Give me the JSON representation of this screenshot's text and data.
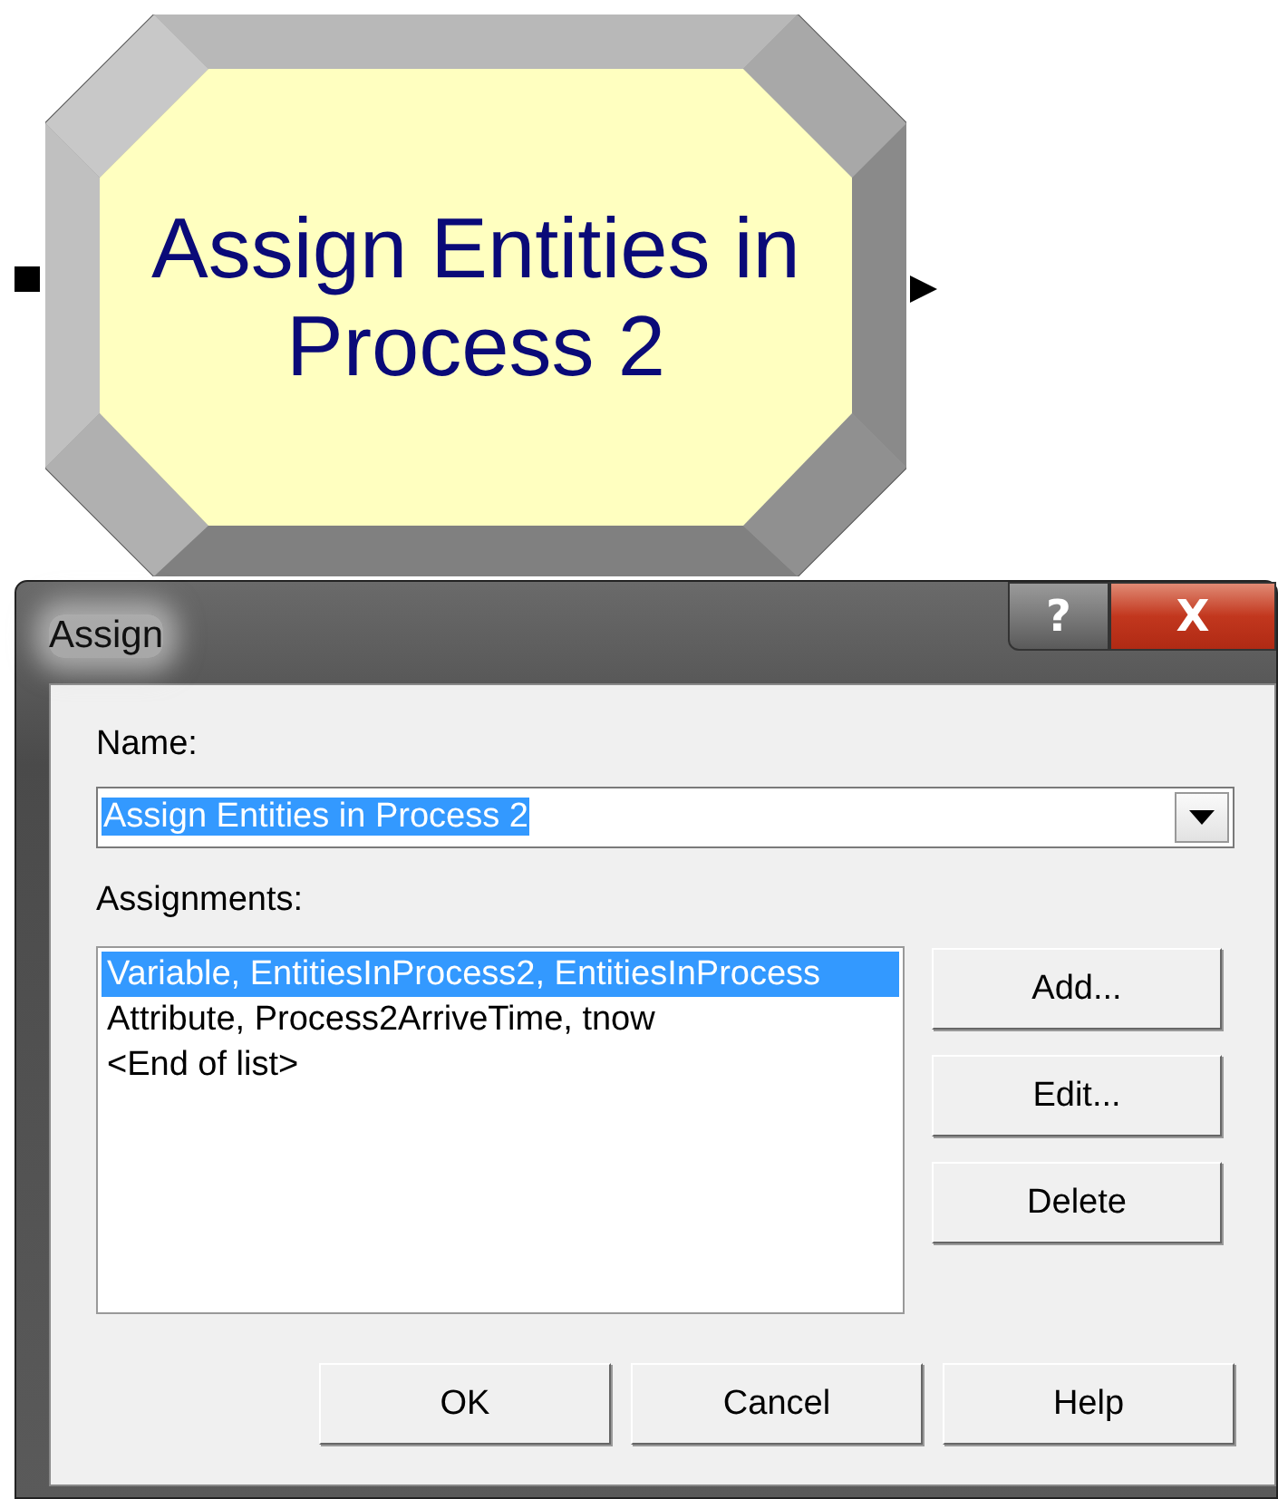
{
  "module": {
    "label": "Assign Entities in Process 2"
  },
  "dialog": {
    "title": "Assign",
    "title_buttons": [
      "?",
      "X"
    ],
    "name_label": "Name:",
    "name_field": {
      "value": "Assign Entities in Process 2",
      "highlighted": true
    },
    "assignments_label": "Assignments:",
    "assignments": [
      {
        "text": "Variable, EntitiesInProcess2, EntitiesInProcess",
        "selected": true
      },
      {
        "text": "Attribute, Process2ArriveTime, tnow",
        "selected": false
      },
      {
        "text": "<End of list>",
        "selected": false
      }
    ],
    "side_buttons": [
      "Add...",
      "Edit...",
      "Delete"
    ],
    "buttons": [
      "OK",
      "Cancel",
      "Help"
    ]
  }
}
